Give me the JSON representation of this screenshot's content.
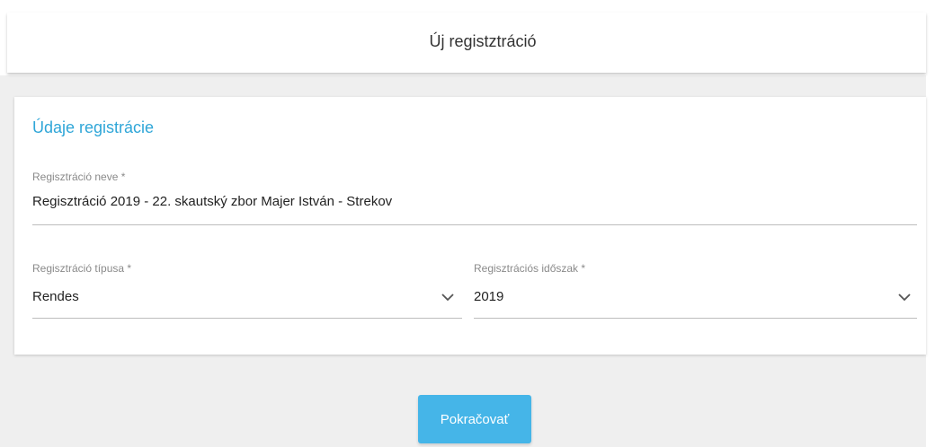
{
  "header": {
    "title": "Új registztráció"
  },
  "card": {
    "section_title": "Údaje registrácie",
    "registration_name": {
      "label": "Regisztráció neve *",
      "value": "Regisztráció 2019 - 22. skautský zbor Majer István - Strekov"
    },
    "registration_type": {
      "label": "Regisztráció típusa *",
      "value": "Rendes"
    },
    "registration_period": {
      "label": "Regisztrációs időszak *",
      "value": "2019"
    }
  },
  "actions": {
    "continue_label": "Pokračovať"
  },
  "colors": {
    "accent": "#2fa6d8",
    "button": "#45b5e8",
    "background": "#efefef"
  }
}
